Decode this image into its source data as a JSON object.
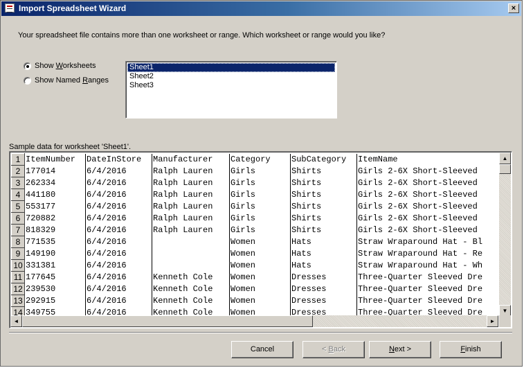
{
  "window": {
    "title": "Import Spreadsheet Wizard",
    "close_label": "×"
  },
  "prompt": "Your spreadsheet file contains more than one worksheet or range. Which worksheet or range would you like?",
  "options": {
    "show_worksheets": {
      "label_pre": "Show ",
      "label_key": "W",
      "label_post": "orksheets",
      "selected": true
    },
    "show_named_ranges": {
      "label_pre": "Show Named ",
      "label_key": "R",
      "label_post": "anges",
      "selected": false
    }
  },
  "sheets": [
    "Sheet1",
    "Sheet2",
    "Sheet3"
  ],
  "selected_sheet": "Sheet1",
  "sample_label": "Sample data for worksheet 'Sheet1'.",
  "table": {
    "rows": [
      {
        "n": "1",
        "cells": [
          "ItemNumber",
          "DateInStore",
          "Manufacturer",
          "Category",
          "SubCategory",
          "ItemName"
        ]
      },
      {
        "n": "2",
        "cells": [
          "177014",
          "6/4/2016",
          "Ralph Lauren",
          "Girls",
          "Shirts",
          "Girls 2-6X Short-Sleeved"
        ]
      },
      {
        "n": "3",
        "cells": [
          "262334",
          "6/4/2016",
          "Ralph Lauren",
          "Girls",
          "Shirts",
          "Girls 2-6X Short-Sleeved"
        ]
      },
      {
        "n": "4",
        "cells": [
          "441180",
          "6/4/2016",
          "Ralph Lauren",
          "Girls",
          "Shirts",
          "Girls 2-6X Short-Sleeved"
        ]
      },
      {
        "n": "5",
        "cells": [
          "553177",
          "6/4/2016",
          "Ralph Lauren",
          "Girls",
          "Shirts",
          "Girls 2-6X Short-Sleeved"
        ]
      },
      {
        "n": "6",
        "cells": [
          "720882",
          "6/4/2016",
          "Ralph Lauren",
          "Girls",
          "Shirts",
          "Girls 2-6X Short-Sleeved"
        ]
      },
      {
        "n": "7",
        "cells": [
          "818329",
          "6/4/2016",
          "Ralph Lauren",
          "Girls",
          "Shirts",
          "Girls 2-6X Short-Sleeved"
        ]
      },
      {
        "n": "8",
        "cells": [
          "771535",
          "6/4/2016",
          "",
          "Women",
          "Hats",
          "Straw Wraparound Hat - Bl"
        ]
      },
      {
        "n": "9",
        "cells": [
          "149190",
          "6/4/2016",
          "",
          "Women",
          "Hats",
          "Straw Wraparound Hat - Re"
        ]
      },
      {
        "n": "10",
        "cells": [
          "331381",
          "6/4/2016",
          "",
          "Women",
          "Hats",
          "Straw Wraparound Hat - Wh"
        ]
      },
      {
        "n": "11",
        "cells": [
          "177645",
          "6/4/2016",
          "Kenneth Cole",
          "Women",
          "Dresses",
          "Three-Quarter Sleeved Dre"
        ]
      },
      {
        "n": "12",
        "cells": [
          "239530",
          "6/4/2016",
          "Kenneth Cole",
          "Women",
          "Dresses",
          "Three-Quarter Sleeved Dre"
        ]
      },
      {
        "n": "13",
        "cells": [
          "292915",
          "6/4/2016",
          "Kenneth Cole",
          "Women",
          "Dresses",
          "Three-Quarter Sleeved Dre"
        ]
      },
      {
        "n": "14",
        "cells": [
          "349755",
          "6/4/2016",
          "Kenneth Cole",
          "Women",
          "Dresses",
          "Three-Quarter Sleeved Dre"
        ]
      }
    ]
  },
  "buttons": {
    "cancel": "Cancel",
    "back": {
      "pre": "< ",
      "key": "B",
      "post": "ack"
    },
    "next": {
      "key": "N",
      "post": "ext >"
    },
    "finish": {
      "key": "F",
      "post": "inish"
    }
  },
  "icons": {
    "app": "spreadsheet-wizard-icon",
    "scroll_up": "▲",
    "scroll_down": "▼",
    "scroll_left": "◄",
    "scroll_right": "►"
  },
  "colors": {
    "face": "#d4d0c8",
    "selection": "#0a246a"
  }
}
